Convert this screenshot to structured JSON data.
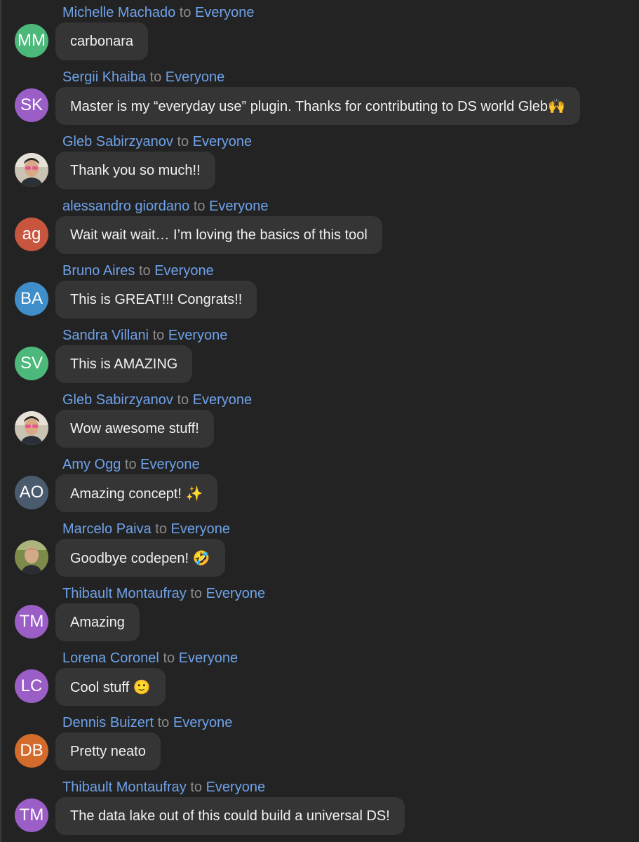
{
  "chat": {
    "to_word": "to",
    "messages": [
      {
        "sender": "Michelle Machado",
        "recipient": "Everyone",
        "initials": "MM",
        "avatar_color": "#4cb97a",
        "text": "carbonara"
      },
      {
        "sender": "Sergii Khaiba",
        "recipient": "Everyone",
        "initials": "SK",
        "avatar_color": "#9a5ec6",
        "text": "Master is my “everyday use” plugin. Thanks for contributing to DS world Gleb",
        "emoji": "🙌"
      },
      {
        "sender": "Gleb Sabirzyanov",
        "recipient": "Everyone",
        "avatar_photo": "photo-avatar-gleb",
        "text": "Thank you so much!!"
      },
      {
        "sender": "alessandro giordano",
        "recipient": "Everyone",
        "initials": "ag",
        "avatar_color": "#c8553e",
        "text": "Wait wait wait… I’m loving the basics of this tool"
      },
      {
        "sender": "Bruno Aires",
        "recipient": "Everyone",
        "initials": "BA",
        "avatar_color": "#3f8ec9",
        "text": "This is GREAT!!! Congrats!!"
      },
      {
        "sender": "Sandra Villani",
        "recipient": "Everyone",
        "initials": "SV",
        "avatar_color": "#4cb97a",
        "text": "This is AMAZING"
      },
      {
        "sender": "Gleb Sabirzyanov",
        "recipient": "Everyone",
        "avatar_photo": "photo-avatar-gleb",
        "text": "Wow awesome stuff!"
      },
      {
        "sender": "Amy Ogg",
        "recipient": "Everyone",
        "initials": "AO",
        "avatar_color": "#4a5b6e",
        "text": "Amazing concept!",
        "emoji": "✨"
      },
      {
        "sender": "Marcelo Paiva",
        "recipient": "Everyone",
        "avatar_photo": "photo-avatar-marcelo",
        "text": "Goodbye codepen!",
        "emoji": "🤣"
      },
      {
        "sender": "Thibault Montaufray",
        "recipient": "Everyone",
        "initials": "TM",
        "avatar_color": "#9a5ec6",
        "text": "Amazing"
      },
      {
        "sender": "Lorena Coronel",
        "recipient": "Everyone",
        "initials": "LC",
        "avatar_color": "#9a5ec6",
        "text": "Cool stuff",
        "emoji": "🙂"
      },
      {
        "sender": "Dennis Buizert",
        "recipient": "Everyone",
        "initials": "DB",
        "avatar_color": "#d26b2c",
        "text": "Pretty neato"
      },
      {
        "sender": "Thibault Montaufray",
        "recipient": "Everyone",
        "initials": "TM",
        "avatar_color": "#9a5ec6",
        "text": "The data lake out of this could build a universal DS!"
      }
    ]
  }
}
